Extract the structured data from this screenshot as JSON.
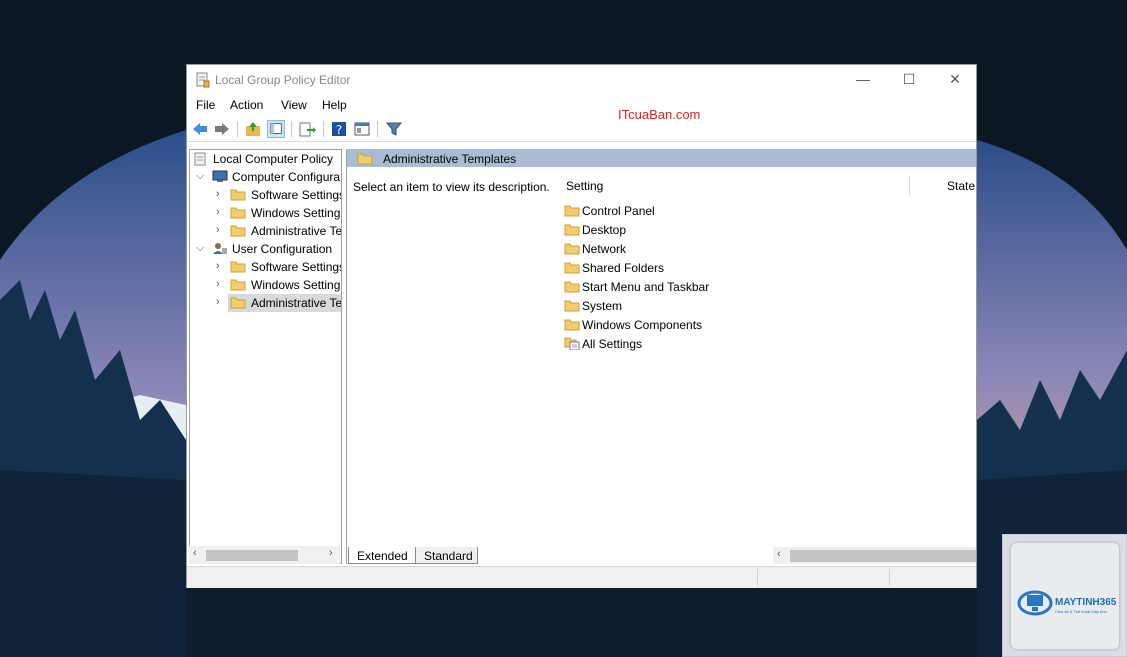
{
  "window": {
    "title": "Local Group Policy Editor",
    "controls": {
      "minimize": "—",
      "maximize": "☐",
      "close": "✕"
    }
  },
  "menu": [
    "File",
    "Action",
    "View",
    "Help"
  ],
  "watermark": "ITcuaBan.com",
  "toolbar": [
    "back-icon",
    "forward-icon",
    "up-folder-icon",
    "show-hide-tree-icon",
    "export-list-icon",
    "help-icon",
    "properties-icon",
    "filter-icon"
  ],
  "tree": {
    "root": "Local Computer Policy",
    "computer_config": {
      "label": "Computer Configura",
      "children": [
        "Software Settings",
        "Windows Setting",
        "Administrative Te"
      ]
    },
    "user_config": {
      "label": "User Configuration",
      "children": [
        "Software Settings",
        "Windows Setting",
        "Administrative Te"
      ]
    }
  },
  "right_pane": {
    "header_title": "Administrative Templates",
    "description": "Select an item to view its description.",
    "columns": {
      "setting": "Setting",
      "state": "State"
    },
    "items": [
      "Control Panel",
      "Desktop",
      "Network",
      "Shared Folders",
      "Start Menu and Taskbar",
      "System",
      "Windows Components",
      "All Settings"
    ]
  },
  "tabs": {
    "extended": "Extended",
    "standard": "Standard"
  },
  "logo": {
    "brand": "MAYTINH365",
    "tagline": "Chia sẻ & Thủ thuật Máy tính"
  }
}
